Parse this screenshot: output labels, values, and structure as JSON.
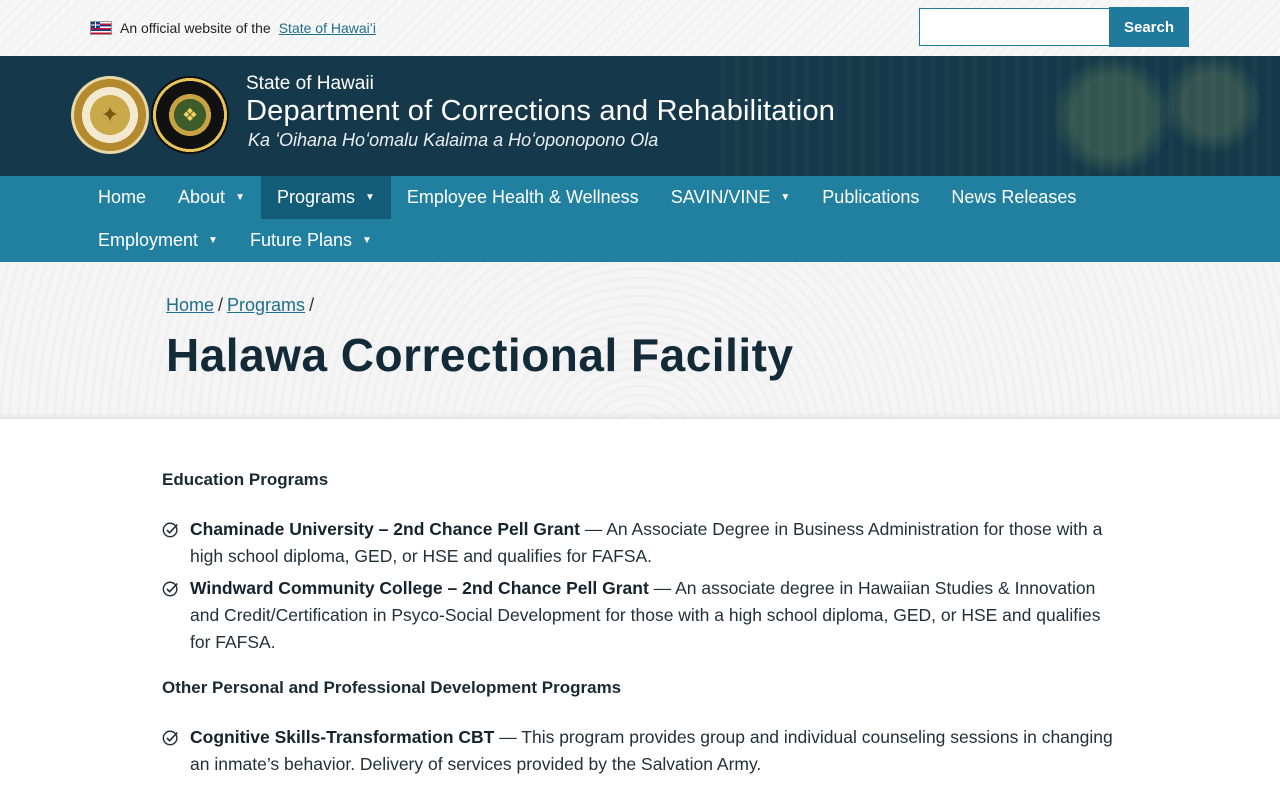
{
  "topbar": {
    "official_text": "An official website of the",
    "official_link": "State of Hawaiʻi",
    "search_placeholder": "",
    "search_button": "Search"
  },
  "header": {
    "state": "State of Hawaii",
    "department": "Department of Corrections and Rehabilitation",
    "motto": "Ka ʻOihana Hoʻomalu Kalaima a Hoʻoponopono Ola"
  },
  "nav": {
    "items": [
      {
        "label": "Home"
      },
      {
        "label": "About"
      },
      {
        "label": "Programs"
      },
      {
        "label": "Employee Health & Wellness"
      },
      {
        "label": "SAVIN/VINE"
      },
      {
        "label": "Publications"
      },
      {
        "label": "News Releases"
      },
      {
        "label": "Employment"
      },
      {
        "label": "Future Plans"
      }
    ]
  },
  "breadcrumb": {
    "home": "Home",
    "programs": "Programs",
    "sep": "/"
  },
  "page": {
    "title": "Halawa Correctional Facility"
  },
  "content": {
    "sections": [
      {
        "heading": "Education Programs",
        "items": [
          {
            "title": "Chaminade University – 2nd Chance Pell Grant",
            "text": " — An Associate Degree in Business Administration for those with a high school diploma, GED, or HSE and qualifies for FAFSA."
          },
          {
            "title": "Windward Community College – 2nd Chance Pell Grant",
            "text": " — An associate degree in Hawaiian Studies & Innovation and Credit/Certification in Psyco-Social Development for those with a high school diploma, GED, or HSE and qualifies for FAFSA."
          }
        ]
      },
      {
        "heading": "Other Personal and Professional Development Programs",
        "items": [
          {
            "title": "Cognitive Skills-Transformation CBT",
            "text": " — This program provides group and individual counseling sessions in changing an inmate’s behavior. Delivery of services provided by the Salvation Army."
          }
        ]
      }
    ]
  }
}
